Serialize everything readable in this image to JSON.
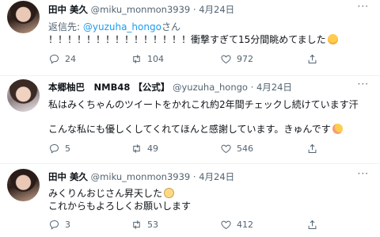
{
  "tweets": [
    {
      "display_name": "田中 美久",
      "handle": "@miku_monmon3939",
      "sep": "·",
      "date": "4月24日",
      "reply_prefix": "返信先: ",
      "reply_handle": "@yuzuha_hongo",
      "reply_suffix": "さん",
      "text_lines": [
        "！！！！！！！！！！！！！！！衝撃すぎて15分間眺めてました"
      ],
      "emoji": "smiling-face",
      "replies": "24",
      "retweets": "104",
      "likes": "972"
    },
    {
      "display_name": "本郷柚巴　NMB48 【公式】",
      "handle": "@yuzuha_hongo",
      "sep": "·",
      "date": "4月24日",
      "text_lines": [
        "私はみくちゃんのツイートをかれこれ約2年間チェックし続けています汗",
        "こんな私にも優しくしてくれてほんと感謝しています。きゅんです"
      ],
      "emoji": "blushing-face",
      "replies": "5",
      "retweets": "49",
      "likes": "546"
    },
    {
      "display_name": "田中 美久",
      "handle": "@miku_monmon3939",
      "sep": "·",
      "date": "4月24日",
      "text_lines": [
        "みくりんおじさん昇天した",
        "これからもよろしくお願いします"
      ],
      "emoji": "angel-face",
      "replies": "3",
      "retweets": "53",
      "likes": "412"
    }
  ],
  "more_label": "···"
}
